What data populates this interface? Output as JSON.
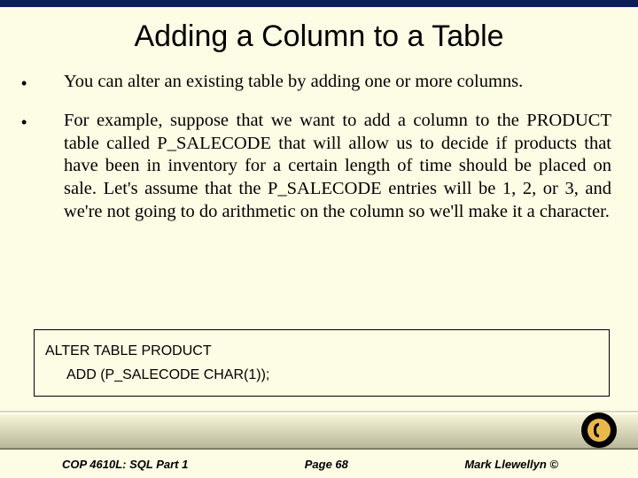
{
  "title": "Adding a Column to a Table",
  "bullets": [
    "You can alter an existing table by adding one or more columns.",
    "For example, suppose that we want to add a column to the PRODUCT table called P_SALECODE that will allow us to decide if products that have been in inventory for a certain length of time should be placed on sale.  Let's assume that the P_SALECODE entries will be 1, 2, or 3, and we're not going to do arithmetic on the column so we'll make it a character."
  ],
  "code": {
    "line1": "ALTER TABLE  PRODUCT",
    "line2": "ADD (P_SALECODE CHAR(1));"
  },
  "footer": {
    "course": "COP 4610L: SQL Part 1",
    "page": "Page 68",
    "author": "Mark Llewellyn ©"
  }
}
